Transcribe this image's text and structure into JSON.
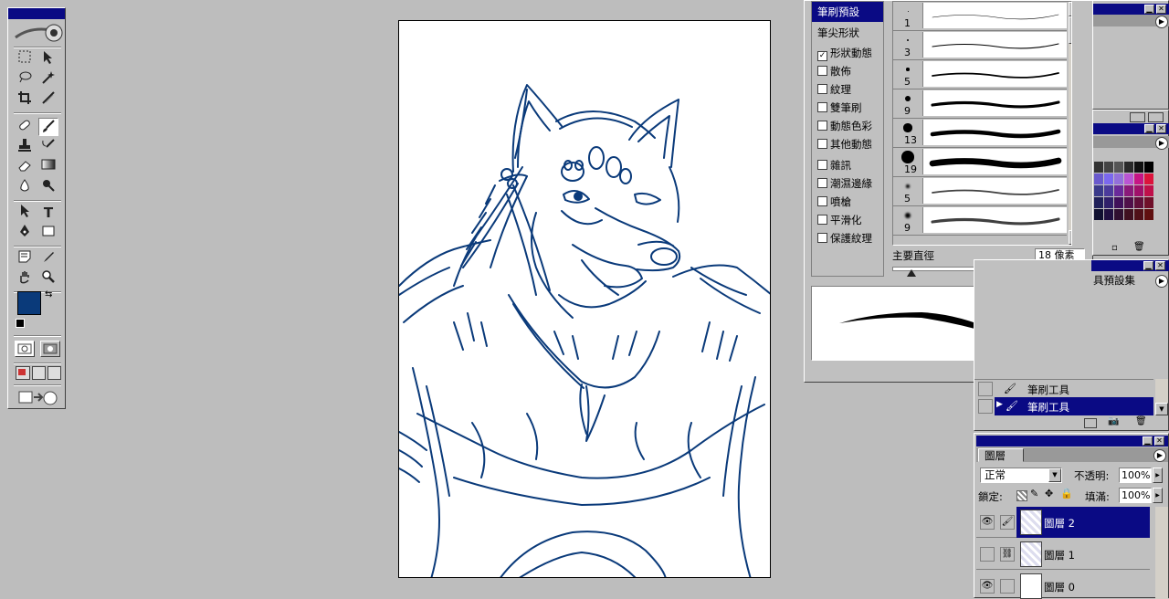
{
  "colors": {
    "line_color": "#0a3a7a",
    "foreground": "#0a3a7a",
    "background": "#ffffff",
    "title_bar": "#0a0a84"
  },
  "toolbox": {
    "tools": [
      "marquee-icon",
      "move-icon",
      "lasso-icon",
      "magic-wand-icon",
      "crop-icon",
      "slice-icon",
      "healing-brush-icon",
      "brush-icon",
      "stamp-icon",
      "history-brush-icon",
      "eraser-icon",
      "gradient-icon",
      "blur-icon",
      "dodge-icon",
      "path-select-icon",
      "type-icon",
      "pen-icon",
      "shape-icon",
      "notes-icon",
      "eyedropper-icon",
      "hand-icon",
      "zoom-icon"
    ],
    "type_tool_glyph": "T"
  },
  "brushes_panel": {
    "menu": {
      "brush_presets": "筆刷預設",
      "tip_shape": "筆尖形狀",
      "options": [
        {
          "label": "形狀動態",
          "checked": true
        },
        {
          "label": "散佈",
          "checked": false
        },
        {
          "label": "紋理",
          "checked": false
        },
        {
          "label": "雙筆刷",
          "checked": false
        },
        {
          "label": "動態色彩",
          "checked": false
        },
        {
          "label": "其他動態",
          "checked": false
        },
        {
          "label": "雜訊",
          "checked": false
        },
        {
          "label": "潮濕邊緣",
          "checked": false
        },
        {
          "label": "噴槍",
          "checked": false
        },
        {
          "label": "平滑化",
          "checked": false
        },
        {
          "label": "保護紋理",
          "checked": false
        }
      ]
    },
    "brush_sizes": [
      "1",
      "3",
      "5",
      "9",
      "13",
      "19",
      "5",
      "9"
    ],
    "master_diameter_label": "主要直徑",
    "master_diameter_value": "18 像素",
    "diameter_fraction": 0.1
  },
  "history_panel": {
    "tab_label": "具預設集",
    "items": [
      "筆刷工具",
      "筆刷工具"
    ]
  },
  "layers_panel": {
    "tab_label": "圖層",
    "blend_mode": "正常",
    "opacity_label": "不透明:",
    "opacity_value": "100%",
    "lock_label": "鎖定:",
    "fill_label": "填滿:",
    "fill_value": "100%",
    "layers": [
      {
        "name": "圖層 2",
        "visible": true,
        "selected": true
      },
      {
        "name": "圖層 1",
        "visible": false,
        "selected": false
      },
      {
        "name": "圖層 0",
        "visible": true,
        "selected": false
      }
    ]
  }
}
